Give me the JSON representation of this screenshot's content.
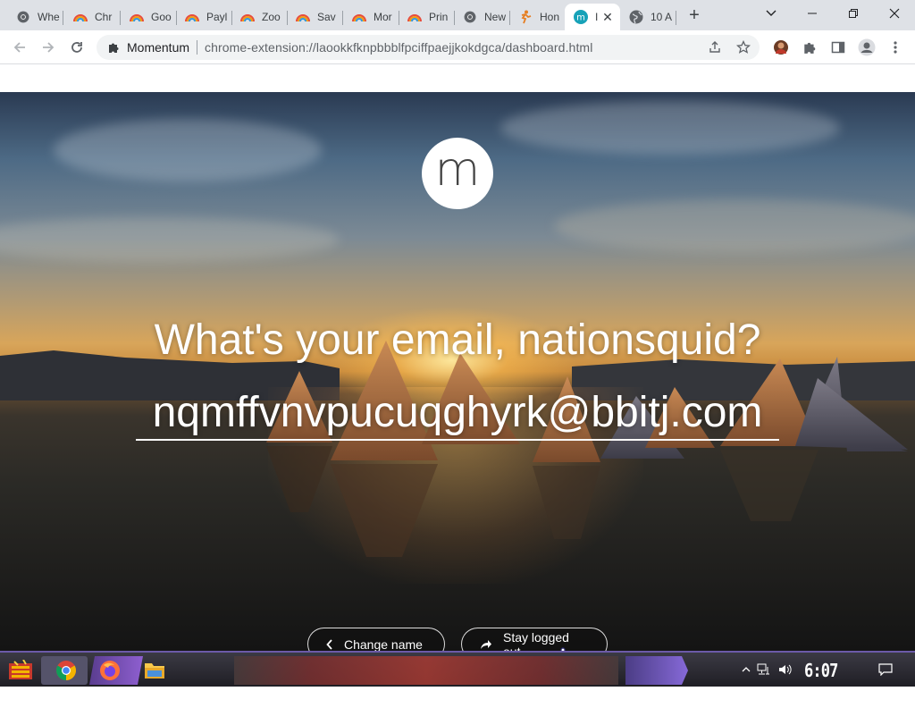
{
  "browser": {
    "tabs": [
      {
        "label": "Whe",
        "icon": "chrome-icon"
      },
      {
        "label": "Chr",
        "icon": "rainbow-icon"
      },
      {
        "label": "Goo",
        "icon": "rainbow-icon"
      },
      {
        "label": "Payl",
        "icon": "rainbow-icon"
      },
      {
        "label": "Zoo",
        "icon": "rainbow-icon"
      },
      {
        "label": "Sav",
        "icon": "rainbow-icon"
      },
      {
        "label": "Mor",
        "icon": "rainbow-icon"
      },
      {
        "label": "Prin",
        "icon": "rainbow-icon"
      },
      {
        "label": "New",
        "icon": "chrome-icon"
      },
      {
        "label": "Hon",
        "icon": "runner-icon"
      },
      {
        "label": "I",
        "icon": "momentum-icon",
        "active": true
      },
      {
        "label": "10 A",
        "icon": "globe-icon"
      }
    ],
    "new_tab_label": "+",
    "omnibox": {
      "extension_name": "Momentum",
      "url": "chrome-extension://laookkfknpbbblfpciffpaejjkokdgca/dashboard.html"
    },
    "colors": {
      "tabstrip": "#dee1e6",
      "omnibox": "#f1f3f4"
    }
  },
  "momentum": {
    "logo_letter": "m",
    "question": "What's your email, nationsquid?",
    "email_value": "nqmffvnvpucuqghyrk@bbitj.com",
    "buttons": {
      "change_name": "Change name",
      "stay_logged_out": "Stay logged out"
    }
  },
  "taskbar": {
    "clock": "6:07 AM",
    "accent": "#6c5aa8"
  }
}
